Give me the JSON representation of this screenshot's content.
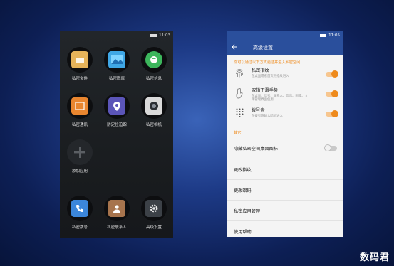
{
  "left_phone": {
    "status_time": "11:03",
    "apps": [
      {
        "label": "私密文件",
        "icon": "folder-icon",
        "color": "#e5b35a"
      },
      {
        "label": "私密图库",
        "icon": "gallery-icon",
        "color": "#3fa7e5"
      },
      {
        "label": "私密信息",
        "icon": "message-icon",
        "color": "#3cb65c"
      },
      {
        "label": "私密通讯",
        "icon": "contacts-book-icon",
        "color": "#e9862f"
      },
      {
        "label": "防定位追踪",
        "icon": "location-pin-icon",
        "color": "#5b55b8"
      },
      {
        "label": "私密相机",
        "icon": "camera-icon",
        "color": "#d9d9d9"
      },
      {
        "label": "添加应用",
        "icon": "plus-icon",
        "color": "#3a3d41"
      }
    ],
    "dock": [
      {
        "label": "私密拨号",
        "icon": "phone-icon",
        "color": "#3b86db"
      },
      {
        "label": "私密联系人",
        "icon": "person-icon",
        "color": "#a7744d"
      },
      {
        "label": "高级设置",
        "icon": "gear-icon",
        "color": "#3c4147"
      }
    ]
  },
  "right_phone": {
    "status_time": "11:05",
    "title": "高级设置",
    "hint": "你可以通过以下方式验证并进入私密空间",
    "methods": [
      {
        "title": "私密指纹",
        "desc": "在桌面或者首页用指纹进入",
        "icon": "fingerprint-icon",
        "enabled": true
      },
      {
        "title": "双指下滑手势",
        "desc": "在桌面、信号、联系人、信息、图库、文件管理界面使用",
        "icon": "two-finger-gesture-icon",
        "enabled": true
      },
      {
        "title": "拨号盘",
        "desc": "在拨号盘输入暗码进入",
        "icon": "dialpad-icon",
        "enabled": true
      }
    ],
    "section_other": "其它",
    "rows": [
      {
        "label": "隐藏私密空间桌面图标",
        "toggle": true,
        "enabled": false
      },
      {
        "label": "更改指纹"
      },
      {
        "label": "更改暗码"
      },
      {
        "label": "私密应用管理"
      },
      {
        "label": "使用帮助"
      }
    ],
    "colors": {
      "appbar": "#2a4f9c",
      "accent": "#ee8a1c"
    }
  },
  "watermark": "数码君"
}
